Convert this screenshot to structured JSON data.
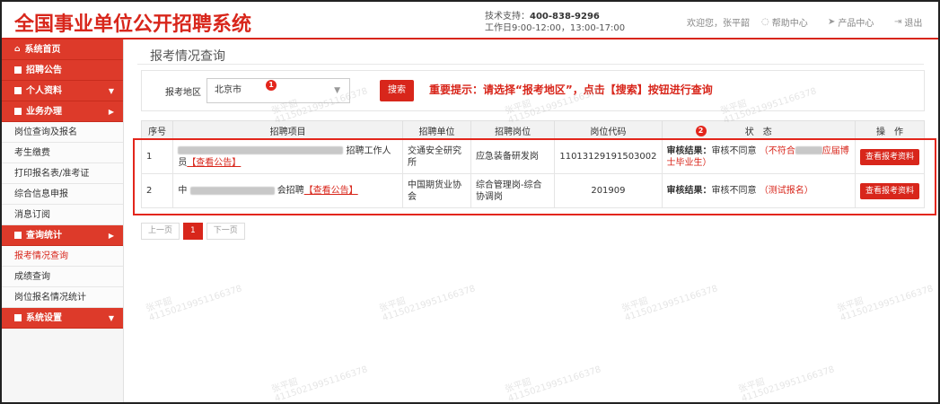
{
  "header": {
    "brand": "全国事业单位公开招聘系统",
    "support_label": "技术支持：",
    "support_phone": "400-838-9296",
    "hours": "工作日9:00-12:00，13:00-17:00",
    "welcome": "欢迎您，张平韶",
    "help": "帮助中心",
    "products": "产品中心",
    "logout": "退出"
  },
  "sidebar": {
    "items": [
      {
        "label": "系统首页"
      },
      {
        "label": "招聘公告"
      },
      {
        "label": "个人资料"
      },
      {
        "label": "业务办理"
      },
      {
        "label": "岗位查询及报名"
      },
      {
        "label": "考生缴费"
      },
      {
        "label": "打印报名表/准考证"
      },
      {
        "label": "综合信息申报"
      },
      {
        "label": "消息订阅"
      },
      {
        "label": "查询统计"
      },
      {
        "label": "报考情况查询"
      },
      {
        "label": "成绩查询"
      },
      {
        "label": "岗位报名情况统计"
      },
      {
        "label": "系统设置"
      }
    ]
  },
  "main": {
    "title": "报考情况查询",
    "filter": {
      "label": "报考地区",
      "region_value": "北京市",
      "search_button": "搜索",
      "tip": "重要提示：请选择“报考地区”，点击【搜索】按钮进行查询"
    },
    "badges": [
      "1",
      "2"
    ],
    "table": {
      "headers": [
        "序号",
        "招聘项目",
        "招聘单位",
        "招聘岗位",
        "岗位代码",
        "状　态",
        "操　作"
      ],
      "rows": [
        {
          "index": "1",
          "project_tail": "招聘工作人",
          "project_line2": "员",
          "project_link": "【查看公告】",
          "unit": "交通安全研究所",
          "post": "应急装备研发岗",
          "code": "11013129191503002",
          "status_key": "审核结果：",
          "status_value": "审核不同意",
          "status_reason_prefix": "（不符合",
          "status_reason_suffix": "应届博士毕业生）",
          "action": "查看报考资料"
        },
        {
          "index": "2",
          "project_head": "中",
          "project_tail": "会招聘",
          "project_link": "【查看公告】",
          "unit": "中国期货业协会",
          "post": "综合管理岗-综合协调岗",
          "code": "201909",
          "status_key": "审核结果：",
          "status_value": "审核不同意",
          "status_reason": "（测试报名）",
          "action": "查看报考资料"
        }
      ]
    },
    "pager": {
      "prev": "上一页",
      "current": "1",
      "next": "下一页"
    }
  },
  "watermark": {
    "name": "张平韶",
    "id": "41150219951166378"
  },
  "colors": {
    "accent": "#d8261b",
    "sidebar_section": "#dd3a2a",
    "highlight_border": "#e3261c"
  }
}
